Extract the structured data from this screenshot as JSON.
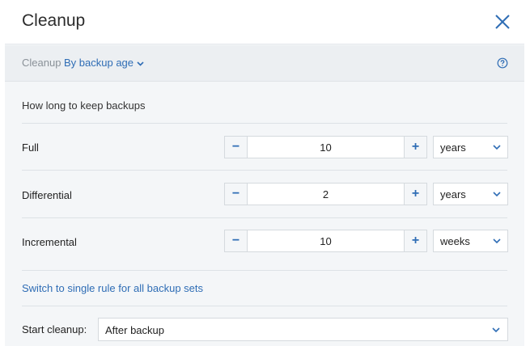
{
  "dialog": {
    "title": "Cleanup"
  },
  "toolbar": {
    "label": "Cleanup",
    "mode_value": "By backup age"
  },
  "section": {
    "title": "How long to keep backups"
  },
  "rows": [
    {
      "label": "Full",
      "minus": "−",
      "value": "10",
      "plus": "+",
      "unit": "years"
    },
    {
      "label": "Differential",
      "minus": "−",
      "value": "2",
      "plus": "+",
      "unit": "years"
    },
    {
      "label": "Incremental",
      "minus": "−",
      "value": "10",
      "plus": "+",
      "unit": "weeks"
    }
  ],
  "switch_link": "Switch to single rule for all backup sets",
  "start_cleanup": {
    "label": "Start cleanup:",
    "value": "After backup"
  },
  "icons": [
    "close-icon",
    "chevron-down-icon",
    "help-icon"
  ],
  "colors": {
    "accent": "#2f6db5",
    "background": "#f4f6f8",
    "border": "#d5dade"
  }
}
